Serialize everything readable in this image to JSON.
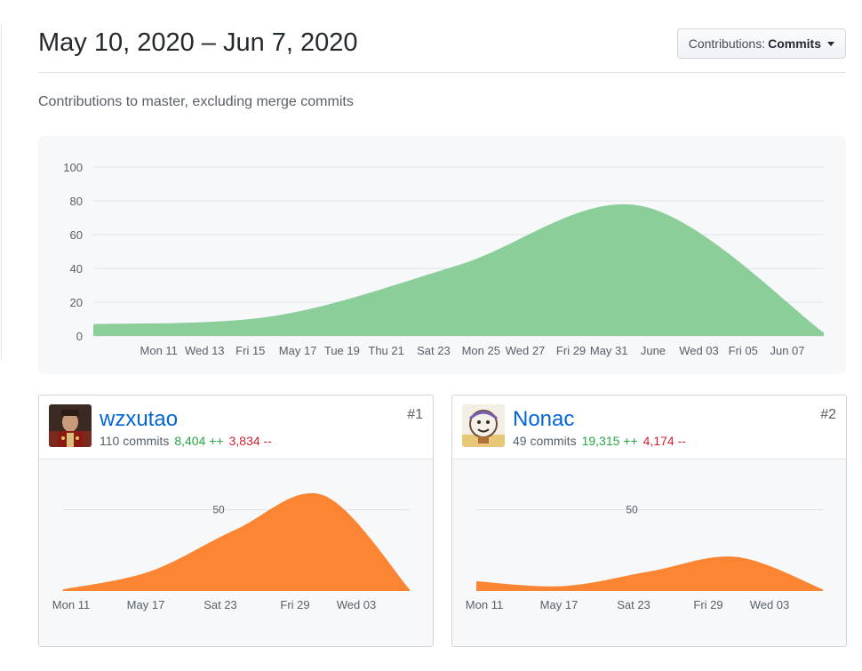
{
  "header": {
    "date_range": "May 10, 2020 – Jun 7, 2020",
    "contrib_prefix": "Contributions:",
    "contrib_value": "Commits"
  },
  "subtitle": "Contributions to master, excluding merge commits",
  "colors": {
    "main_area": "#8cce9a",
    "contributor_area": "#fb8532",
    "link": "#0366d6",
    "additions": "#28a745",
    "deletions": "#cb2431"
  },
  "chart_data": [
    {
      "type": "area",
      "ylim": [
        0,
        100
      ],
      "yticks": [
        "100",
        "80",
        "60",
        "40",
        "20",
        "0"
      ],
      "xticks": [
        "Mon 11",
        "Wed 13",
        "Fri 15",
        "May 17",
        "Tue 19",
        "Thu 21",
        "Sat 23",
        "Mon 25",
        "Wed 27",
        "Fri 29",
        "May 31",
        "June",
        "Wed 03",
        "Fri 05",
        "Jun 07"
      ],
      "x": [
        "May 10",
        "May 17",
        "May 24",
        "May 31",
        "Jun 07"
      ],
      "values": [
        7,
        12,
        42,
        77,
        2
      ]
    },
    {
      "type": "area",
      "series": [
        {
          "name": "wzxutao",
          "values": [
            1,
            12,
            38,
            59,
            1
          ]
        }
      ],
      "gridline": "50",
      "xticks": [
        "Mon 11",
        "May 17",
        "Sat 23",
        "Fri 29",
        "Wed 03"
      ],
      "ylim": [
        0,
        70
      ]
    },
    {
      "type": "area",
      "series": [
        {
          "name": "Nonac",
          "values": [
            6,
            3,
            12,
            21,
            1
          ]
        }
      ],
      "gridline": "50",
      "xticks": [
        "Mon 11",
        "May 17",
        "Sat 23",
        "Fri 29",
        "Wed 03"
      ],
      "ylim": [
        0,
        70
      ]
    }
  ],
  "contributors": [
    {
      "name": "wzxutao",
      "commits": "110 commits",
      "additions": "8,404 ++",
      "deletions": "3,834 --",
      "rank": "#1",
      "avatar": "person-avatar-icon"
    },
    {
      "name": "Nonac",
      "commits": "49 commits",
      "additions": "19,315 ++",
      "deletions": "4,174 --",
      "rank": "#2",
      "avatar": "cartoon-avatar-icon"
    }
  ]
}
